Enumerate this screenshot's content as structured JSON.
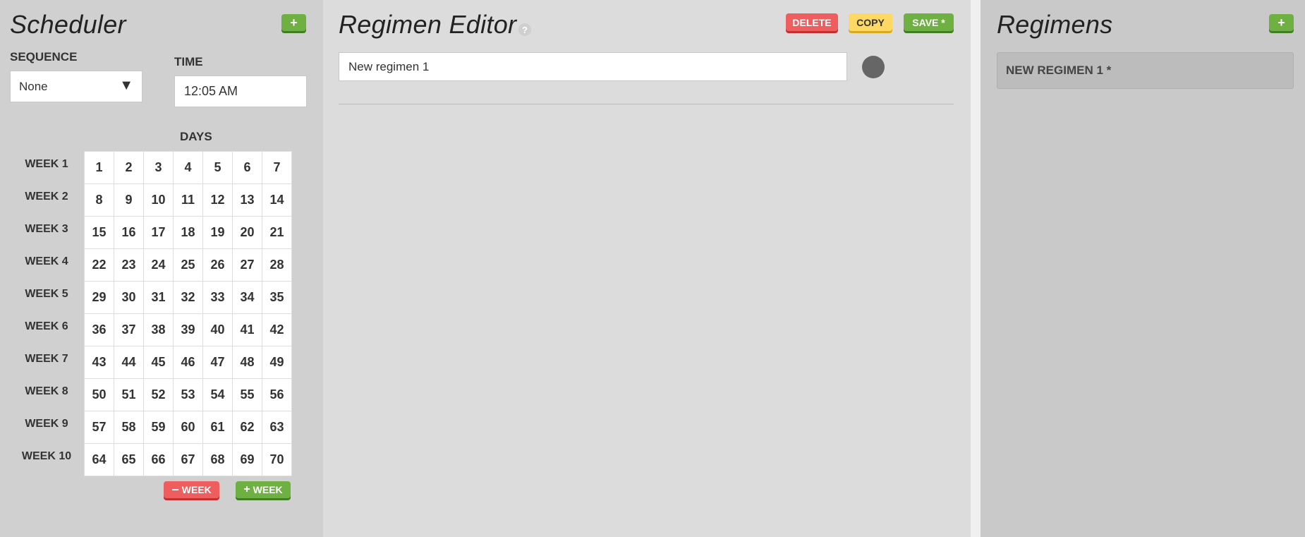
{
  "scheduler": {
    "title": "Scheduler",
    "add_label": "+",
    "sequence_label": "SEQUENCE",
    "sequence_value": "None",
    "time_label": "TIME",
    "time_value": "12:05 AM",
    "days_label": "DAYS",
    "weeks": [
      {
        "label": "WEEK 1",
        "days": [
          "1",
          "2",
          "3",
          "4",
          "5",
          "6",
          "7"
        ]
      },
      {
        "label": "WEEK 2",
        "days": [
          "8",
          "9",
          "10",
          "11",
          "12",
          "13",
          "14"
        ]
      },
      {
        "label": "WEEK 3",
        "days": [
          "15",
          "16",
          "17",
          "18",
          "19",
          "20",
          "21"
        ]
      },
      {
        "label": "WEEK 4",
        "days": [
          "22",
          "23",
          "24",
          "25",
          "26",
          "27",
          "28"
        ]
      },
      {
        "label": "WEEK 5",
        "days": [
          "29",
          "30",
          "31",
          "32",
          "33",
          "34",
          "35"
        ]
      },
      {
        "label": "WEEK 6",
        "days": [
          "36",
          "37",
          "38",
          "39",
          "40",
          "41",
          "42"
        ]
      },
      {
        "label": "WEEK 7",
        "days": [
          "43",
          "44",
          "45",
          "46",
          "47",
          "48",
          "49"
        ]
      },
      {
        "label": "WEEK 8",
        "days": [
          "50",
          "51",
          "52",
          "53",
          "54",
          "55",
          "56"
        ]
      },
      {
        "label": "WEEK 9",
        "days": [
          "57",
          "58",
          "59",
          "60",
          "61",
          "62",
          "63"
        ]
      },
      {
        "label": "WEEK 10",
        "days": [
          "64",
          "65",
          "66",
          "67",
          "68",
          "69",
          "70"
        ]
      }
    ],
    "remove_week_label": "WEEK",
    "add_week_label": "WEEK",
    "minus_icon": "minus-icon",
    "plus_icon": "plus-icon"
  },
  "editor": {
    "title": "Regimen Editor",
    "help_icon": "?",
    "delete_label": "DELETE",
    "copy_label": "COPY",
    "save_label": "SAVE *",
    "name_value": "New regimen 1",
    "color": "#666666"
  },
  "regimens": {
    "title": "Regimens",
    "add_label": "+",
    "items": [
      "NEW REGIMEN 1 *"
    ]
  },
  "colors": {
    "green": "#6fb043",
    "red": "#ef5e5e",
    "yellow": "#fdd863"
  }
}
